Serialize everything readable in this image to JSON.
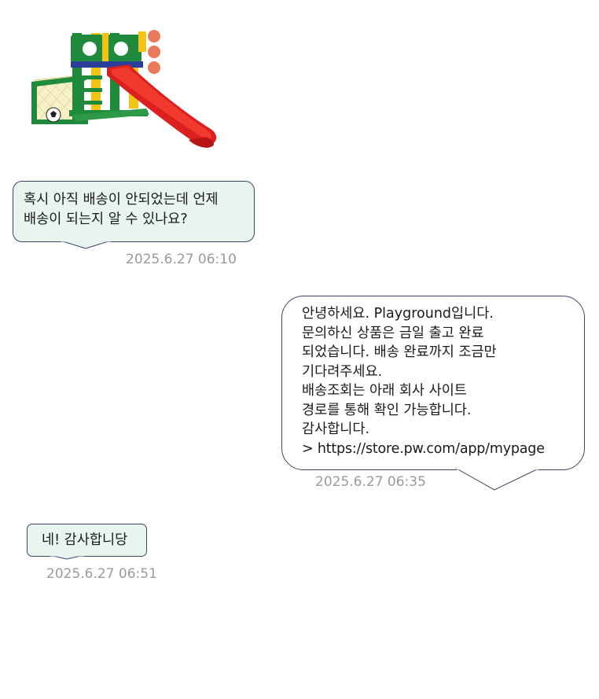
{
  "product": {
    "image_desc": "outdoor-playset-with-slide-and-goal"
  },
  "messages": [
    {
      "sender": "customer",
      "lines": [
        "혹시 아직 배송이 안되었는데 언제",
        "배송이 되는지 알 수 있나요?"
      ],
      "timestamp": "2025.6.27 06:10"
    },
    {
      "sender": "staff",
      "lines": [
        "안녕하세요. Playground입니다.",
        "문의하신 상품은 금일 출고 완료",
        "되었습니다. 배송 완료까지 조금만",
        "기다려주세요.",
        "배송조회는 아래 회사 사이트",
        "경로를 통해 확인 가능합니다.",
        "감사합니다.",
        "> https://store.pw.com/app/mypage"
      ],
      "timestamp": "2025.6.27 06:35"
    },
    {
      "sender": "customer",
      "lines": [
        "네! 감사합니당"
      ],
      "timestamp": "2025.6.27 06:51"
    }
  ],
  "colors": {
    "customer_bubble": "#e8f4ee",
    "staff_bubble": "#ffffff",
    "bubble_border": "#3a4566",
    "timestamp": "#9a9a9a"
  }
}
